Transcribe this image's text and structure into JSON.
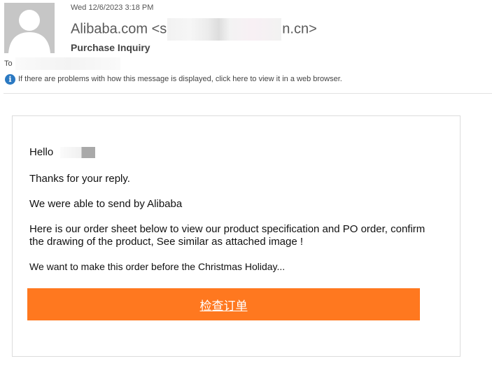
{
  "header": {
    "date": "Wed 12/6/2023 3:18 PM",
    "sender_prefix": "Alibaba.com <s",
    "sender_suffix": "n.cn>",
    "subject": "Purchase Inquiry",
    "to_label": "To",
    "info_message": "If there are problems with how this message is displayed, click here to view it in a web browser."
  },
  "icons": {
    "avatar": "person-silhouette-icon",
    "info": "info-icon"
  },
  "body": {
    "greeting": "Hello",
    "p1": "Thanks for your reply.",
    "p2": "We were able to send by Alibaba",
    "p3": "Here is our order sheet below to view our product specification and PO order, confirm the drawing of the product, See similar as attached image !",
    "p4": "We want to make this order before the Christmas Holiday...",
    "cta_label": "检查订单"
  },
  "colors": {
    "cta": "#ff781f",
    "info_icon": "#2b79c2"
  }
}
